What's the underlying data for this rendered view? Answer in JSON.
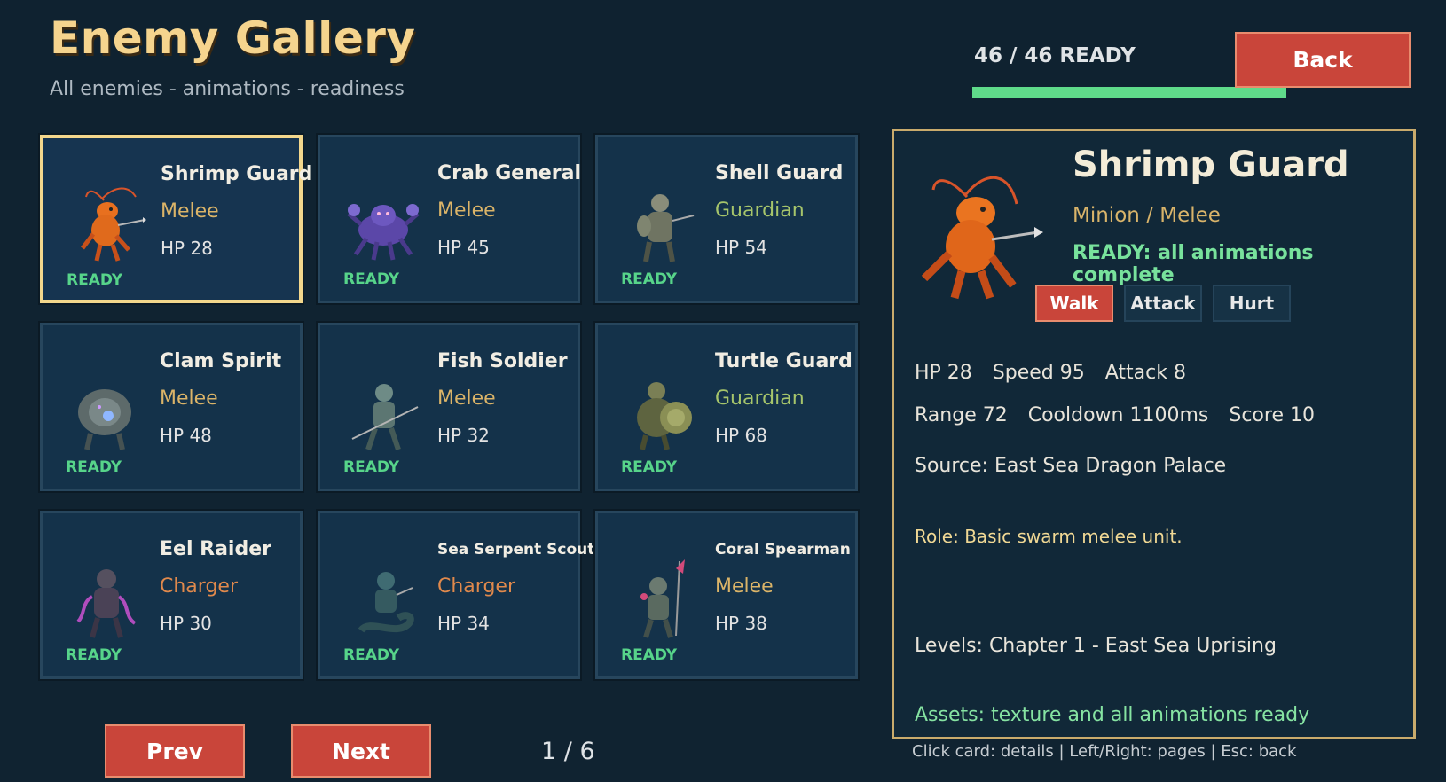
{
  "header": {
    "title": "Enemy Gallery",
    "subtitle": "All enemies - animations - readiness",
    "ready_count": "46 / 46 READY",
    "ready_fraction": 1.0,
    "back_label": "Back"
  },
  "cards": [
    {
      "name": "Shrimp Guard",
      "role": "Melee",
      "role_color": "#dbb468",
      "hp": "HP 28",
      "status": "READY",
      "icon": "shrimp-guard-sprite"
    },
    {
      "name": "Crab General",
      "role": "Melee",
      "role_color": "#dbb468",
      "hp": "HP 45",
      "status": "READY",
      "icon": "crab-general-sprite"
    },
    {
      "name": "Shell Guard",
      "role": "Guardian",
      "role_color": "#a6c56b",
      "hp": "HP 54",
      "status": "READY",
      "icon": "shell-guard-sprite"
    },
    {
      "name": "Clam Spirit",
      "role": "Melee",
      "role_color": "#dbb468",
      "hp": "HP 48",
      "status": "READY",
      "icon": "clam-spirit-sprite"
    },
    {
      "name": "Fish Soldier",
      "role": "Melee",
      "role_color": "#dbb468",
      "hp": "HP 32",
      "status": "READY",
      "icon": "fish-soldier-sprite"
    },
    {
      "name": "Turtle Guard",
      "role": "Guardian",
      "role_color": "#a6c56b",
      "hp": "HP 68",
      "status": "READY",
      "icon": "turtle-guard-sprite"
    },
    {
      "name": "Eel Raider",
      "role": "Charger",
      "role_color": "#e0894c",
      "hp": "HP 30",
      "status": "READY",
      "icon": "eel-raider-sprite"
    },
    {
      "name": "Sea Serpent Scout",
      "role": "Charger",
      "role_color": "#e0894c",
      "hp": "HP 34",
      "status": "READY",
      "icon": "sea-serpent-scout-sprite"
    },
    {
      "name": "Coral Spearman",
      "role": "Melee",
      "role_color": "#dbb468",
      "hp": "HP 38",
      "status": "READY",
      "icon": "coral-spearman-sprite"
    }
  ],
  "detail": {
    "name": "Shrimp Guard",
    "class": "Minion / Melee",
    "status": "READY: all animations complete",
    "anim_tabs": [
      "Walk",
      "Attack",
      "Hurt"
    ],
    "active_tab": "Walk",
    "stats1": [
      "HP 28",
      "Speed 95",
      "Attack 8"
    ],
    "stats2": [
      "Range 72",
      "Cooldown 1100ms",
      "Score 10"
    ],
    "source": "Source: East Sea Dragon Palace",
    "role": "Role: Basic swarm melee unit.",
    "levels": "Levels: Chapter 1 - East Sea Uprising",
    "assets": "Assets: texture and all animations ready"
  },
  "pager": {
    "prev_label": "Prev",
    "next_label": "Next",
    "page": "1 / 6"
  },
  "help": "Click card: details | Left/Right: pages | Esc: back",
  "colors": {
    "accent_red": "#c9453a",
    "ready_green": "#57d48a",
    "title_gold": "#f5d48e",
    "selected_border": "#f3d78c"
  }
}
